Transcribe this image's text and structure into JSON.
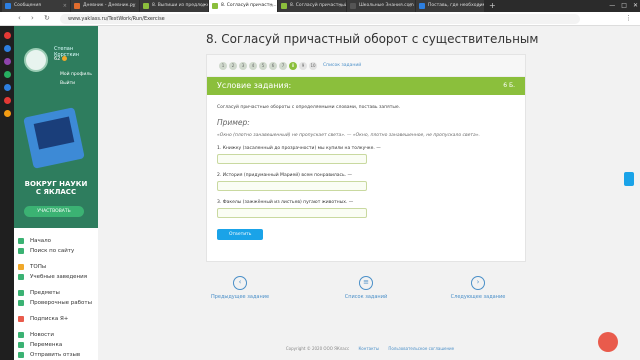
{
  "browser": {
    "tabs": [
      {
        "label": "Сообщения",
        "color": "#2d7fe0",
        "active": false
      },
      {
        "label": "Дневник - Дневник.ру",
        "color": "#e06c2d",
        "active": false
      },
      {
        "label": "8. Выпиши из предложе...",
        "color": "#8bbf3c",
        "active": false
      },
      {
        "label": "8. Согласуй причастн...",
        "color": "#8bbf3c",
        "active": true
      },
      {
        "label": "8. Согласуй причастный ...",
        "color": "#8bbf3c",
        "active": false
      },
      {
        "label": "Школьные Знания.com",
        "color": "#555555",
        "active": false
      },
      {
        "label": "Поставь, где необходим...",
        "color": "#2d7fe0",
        "active": false
      }
    ],
    "url": "www.yaklass.ru/TestWork/Run/Exercise"
  },
  "sidebar": {
    "user_name": "Степан Корсткин",
    "points": "62",
    "profile": "Мой профиль",
    "logout": "Выйти",
    "promo_line1": "ВОКРУГ НАУКИ",
    "promo_line2": "С ЯКЛАСС",
    "promo_cta": "УЧАСТВОВАТЬ",
    "menu": [
      {
        "label": "Начало",
        "color": "#3bb273"
      },
      {
        "label": "Поиск по сайту",
        "color": "#3bb273"
      },
      {
        "label": "ТОПы",
        "color": "#f0a82a"
      },
      {
        "label": "Учебные заведения",
        "color": "#3bb273"
      },
      {
        "label": "Предметы",
        "color": "#3bb273"
      },
      {
        "label": "Проверочные работы",
        "color": "#3bb273"
      },
      {
        "label": "Подписка Я+",
        "color": "#e95b4c"
      },
      {
        "label": "Новости",
        "color": "#3bb273"
      },
      {
        "label": "Переменка",
        "color": "#3bb273"
      },
      {
        "label": "Отправить отзыв",
        "color": "#3bb273"
      }
    ]
  },
  "page_title": "8. Согласуй причастный оборот с существительным",
  "pager": {
    "items": [
      "1",
      "2",
      "3",
      "4",
      "5",
      "6",
      "7",
      "8",
      "9",
      "10"
    ],
    "current": "8",
    "list_link": "Список заданий"
  },
  "task": {
    "heading": "Условие задания:",
    "points": "6 Б.",
    "instruction": "Согласуй причастные обороты с определяемыми словами, поставь запятые.",
    "example_label": "Пример:",
    "example_text": "«Окно (плотно занавешенный) не пропускает света». — «Окно, плотно занавешенное, не пропускало света».",
    "questions": [
      "1. Книжку (засаленный до прозрачности) мы купили на толкучке. —",
      "2. История (придуманный Марией) всем понравилась. —",
      "3. Факелы (зажжённый из листьев) пугают животных. —"
    ],
    "answer_button": "Ответить"
  },
  "nav": {
    "prev": "Предыдущее задание",
    "list": "Список заданий",
    "next": "Следующее задание"
  },
  "footer": {
    "copyright": "Copyright © 2020 ООО ЯКласс",
    "contacts": "Контакты",
    "agreement": "Пользовательское соглашение"
  }
}
